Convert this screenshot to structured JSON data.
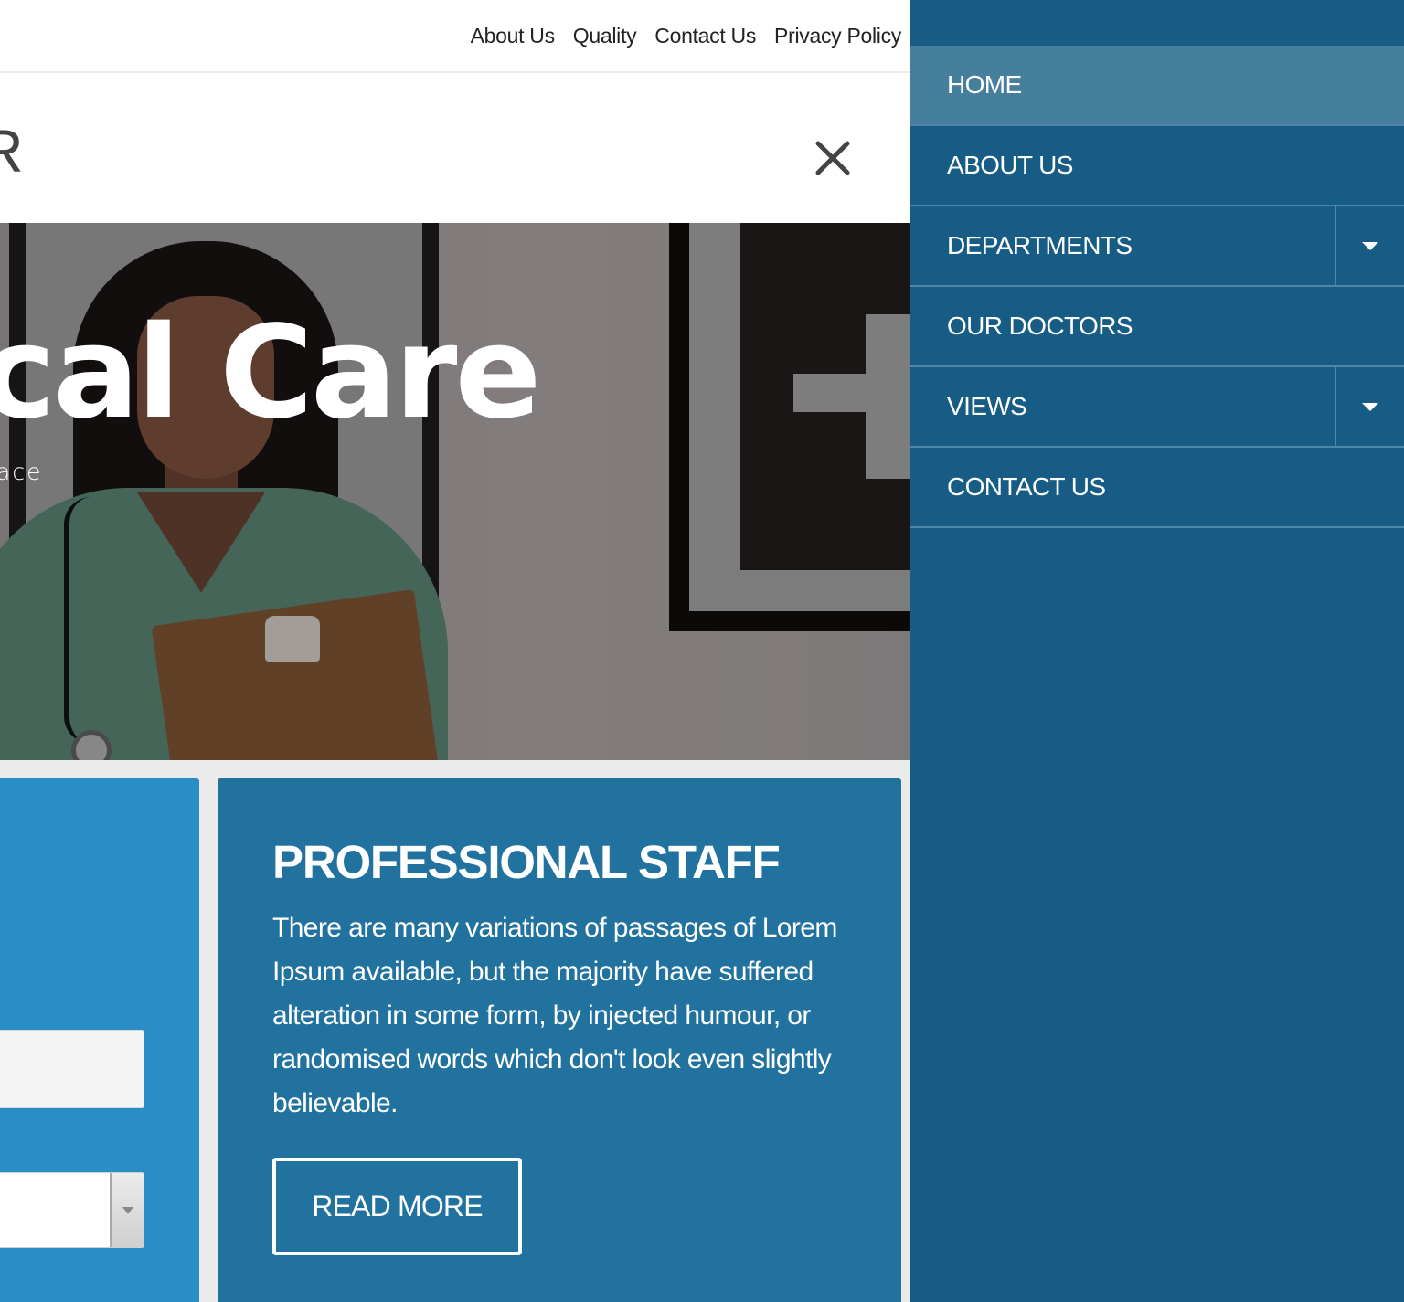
{
  "topbar": {
    "links": [
      "About Us",
      "Quality",
      "Contact Us",
      "Privacy Policy"
    ]
  },
  "header": {
    "logo_fragment": "R",
    "close_icon": "close-icon"
  },
  "hero": {
    "title_fragment": "cal Care",
    "subtitle_fragment": "ace"
  },
  "cards": {
    "left": {
      "text_field_value": "",
      "select_value": ""
    },
    "right": {
      "title": "PROFESSIONAL STAFF",
      "body": "There are many variations of passages of Lorem Ipsum available, but the majority have suffered alteration in some form, by injected humour, or randomised words which don't look even slightly believable.",
      "button_label": "READ MORE"
    }
  },
  "offcanvas_menu": {
    "items": [
      {
        "label": "HOME",
        "active": true,
        "has_submenu": false
      },
      {
        "label": "ABOUT US",
        "active": false,
        "has_submenu": false
      },
      {
        "label": "DEPARTMENTS",
        "active": false,
        "has_submenu": true
      },
      {
        "label": "OUR DOCTORS",
        "active": false,
        "has_submenu": false
      },
      {
        "label": "VIEWS",
        "active": false,
        "has_submenu": true
      },
      {
        "label": "CONTACT US",
        "active": false,
        "has_submenu": false
      }
    ]
  },
  "colors": {
    "menu_bg": "#165c85",
    "menu_active_bg": "#467e9d",
    "menu_divider": "#4f86a9",
    "card_left_bg": "#2a8ec6",
    "card_right_bg": "#21729f"
  }
}
